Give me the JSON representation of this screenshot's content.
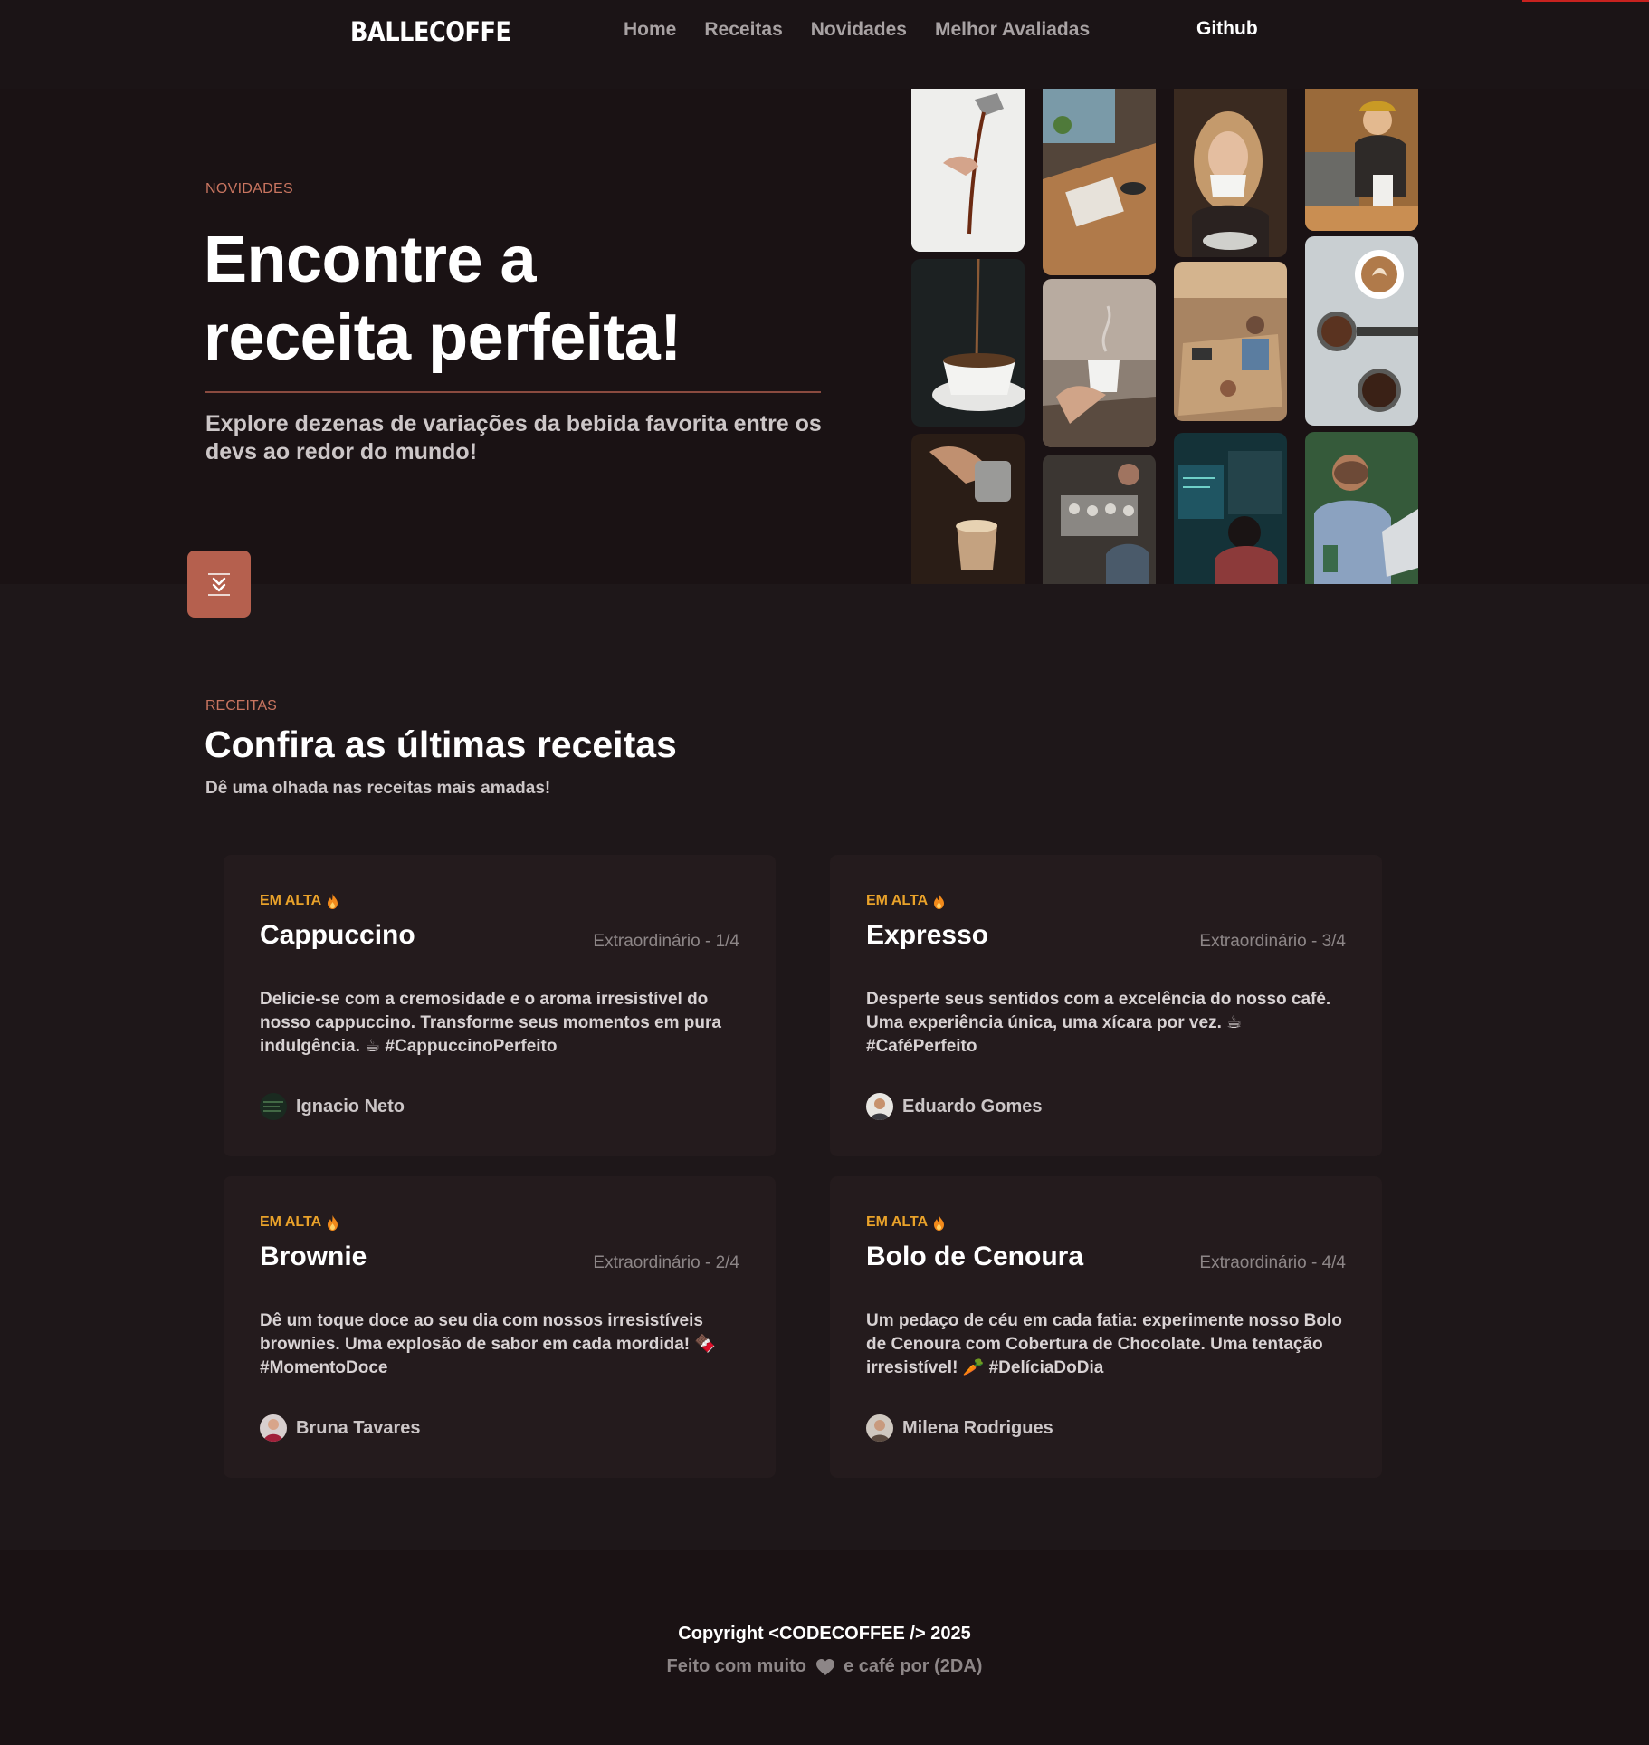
{
  "header": {
    "logo": "BALLECOFFE",
    "nav": [
      "Home",
      "Receitas",
      "Novidades",
      "Melhor Avaliadas"
    ],
    "github": "Github"
  },
  "hero": {
    "eyebrow": "NOVIDADES",
    "title_line1": "Encontre a",
    "title_line2": "receita perfeita!",
    "subtitle": "Explore dezenas de variações da bebida favorita entre os devs ao redor do mundo!",
    "scroll_icon": "chevrons-down-icon",
    "photos": [
      "photo-pouring-coffee",
      "photo-desk-window",
      "photo-woman-cup",
      "photo-barista",
      "photo-cup-saucer",
      "photo-hand-cup",
      "photo-coworking-office",
      "photo-latte-art-beans",
      "photo-latte-pour",
      "photo-barista-team",
      "photo-developer-screens",
      "photo-man-laptop"
    ]
  },
  "recipes": {
    "eyebrow": "RECEITAS",
    "title": "Confira as últimas receitas",
    "subtitle": "Dê uma olhada nas receitas mais amadas!",
    "cards": [
      {
        "badge": "EM ALTA",
        "title": "Cappuccino",
        "rating": "Extraordinário - 1/4",
        "description": "Delicie-se com a cremosidade e o aroma irresistível do nosso cappuccino. Transforme seus momentos em pura indulgência. ☕ #CappuccinoPerfeito",
        "author": "Ignacio Neto"
      },
      {
        "badge": "EM ALTA",
        "title": "Expresso",
        "rating": "Extraordinário - 3/4",
        "description": "Desperte seus sentidos com a excelência do nosso café. Uma experiência única, uma xícara por vez. ☕ #CaféPerfeito",
        "author": "Eduardo Gomes"
      },
      {
        "badge": "EM ALTA",
        "title": "Brownie",
        "rating": "Extraordinário - 2/4",
        "description": "Dê um toque doce ao seu dia com nossos irresistíveis brownies. Uma explosão de sabor em cada mordida! 🍫 #MomentoDoce",
        "author": "Bruna Tavares"
      },
      {
        "badge": "EM ALTA",
        "title": "Bolo de Cenoura",
        "rating": "Extraordinário - 4/4",
        "description": "Um pedaço de céu em cada fatia: experimente nosso Bolo de Cenoura com Cobertura de Chocolate. Uma tentação irresistível! 🥕 #DelíciaDoDia",
        "author": "Milena Rodrigues"
      }
    ]
  },
  "footer": {
    "copyright": "Copyright <CODECOFFEE /> 2025",
    "made_prefix": "Feito com muito",
    "made_suffix": "e café por (2DA)"
  },
  "colors": {
    "background": "#1e1719",
    "accent": "#b5604e",
    "eyebrow": "#c97560",
    "badge": "#e9a22a",
    "card": "#241b1d"
  }
}
